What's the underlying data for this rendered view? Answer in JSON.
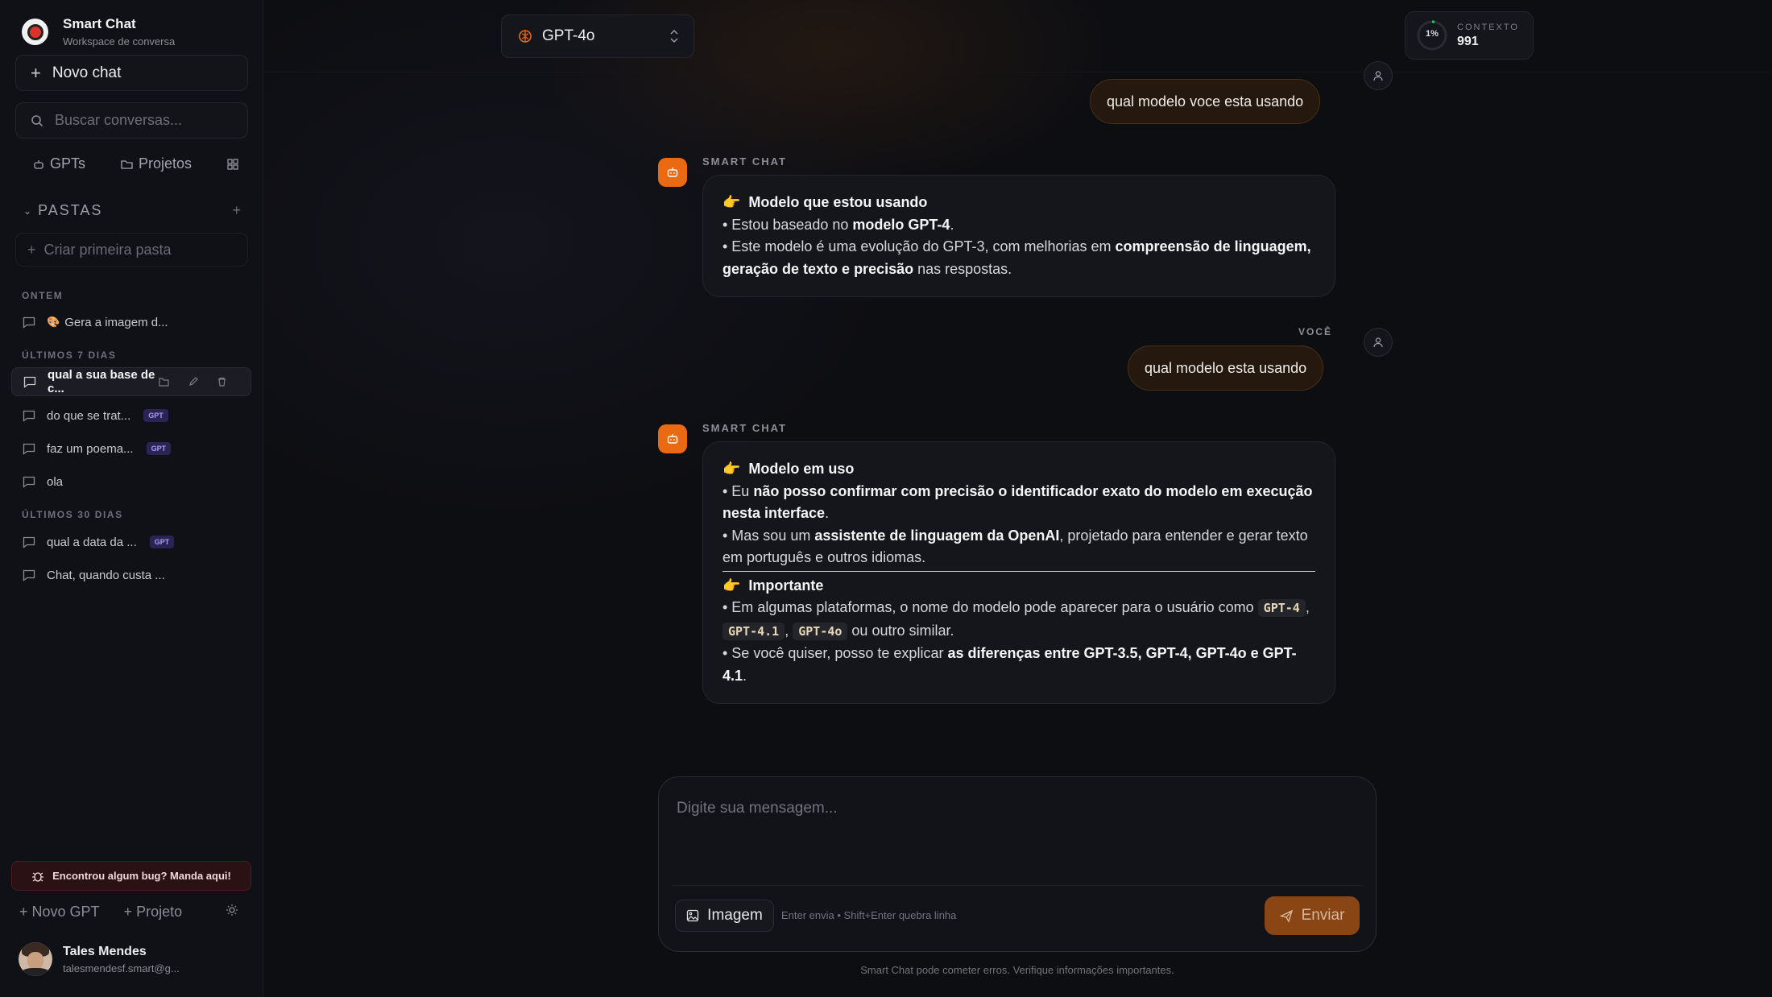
{
  "sidebar": {
    "app_title": "Smart Chat",
    "app_subtitle": "Workspace de conversa",
    "new_chat": "Novo chat",
    "search_placeholder": "Buscar conversas...",
    "tabs": {
      "gpts": "GPTs",
      "projetos": "Projetos"
    },
    "pastas_label": "PASTAS",
    "criar_pasta": "Criar primeira pasta",
    "groups": {
      "ontem": "ONTEM",
      "ultimos7": "ÚLTIMOS 7 DIAS",
      "ultimos30": "ÚLTIMOS 30 DIAS"
    },
    "chats": [
      {
        "title": "Gera a imagem d...",
        "emoji": "🎨"
      },
      {
        "title": "qual a sua base de c..."
      },
      {
        "title": "do que se trat...",
        "badge": "GPT"
      },
      {
        "title": "faz um poema...",
        "badge": "GPT"
      },
      {
        "title": "ola"
      },
      {
        "title": "qual a data da ...",
        "badge": "GPT"
      },
      {
        "title": "Chat, quando custa ..."
      }
    ],
    "bug_report": "Encontrou algum bug? Manda aqui!",
    "novo_gpt": "Novo GPT",
    "projeto": "Projeto",
    "user": {
      "name": "Tales Mendes",
      "email": "talesmendesf.smart@g..."
    }
  },
  "header": {
    "model": "GPT-4o",
    "context_label": "CONTEXTO",
    "context_value": "991",
    "context_percent": "1%",
    "context_fraction": 0.01
  },
  "messages": {
    "user1": "qual modelo voce esta usando",
    "bot_name": "SMART CHAT",
    "you_label": "VOCÊ",
    "bot1": {
      "heading": "Modelo que estou usando",
      "l1a": "• Estou baseado no ",
      "l1b": "modelo GPT-4",
      "l1c": ".",
      "l2a": "• Este modelo é uma evolução do GPT-3, com melhorias em ",
      "l2b": "compreensão de linguagem, geração de texto e precisão",
      "l2c": " nas respostas."
    },
    "user2": "qual modelo esta usando",
    "bot2": {
      "heading1": "Modelo em uso",
      "l1a": "• Eu ",
      "l1b": "não posso confirmar com precisão o identificador exato do modelo em execução nesta interface",
      "l1c": ".",
      "l2a": "• Mas sou um ",
      "l2b": "assistente de linguagem da OpenAI",
      "l2c": ", projetado para entender e gerar texto em português e outros idiomas.",
      "heading2": "Importante",
      "l3a": "• Em algumas plataformas, o nome do modelo pode aparecer para o usuário como ",
      "code1": "GPT-4",
      "code2": "GPT-4.1",
      "code3": "GPT-4o",
      "comma": ", ",
      "l3b": " ou outro similar.",
      "l4a": "• Se você quiser, posso te explicar ",
      "l4b": "as diferenças entre GPT-3.5, GPT-4, GPT-4o e GPT-4.1",
      "l4c": "."
    }
  },
  "composer": {
    "placeholder": "Digite sua mensagem...",
    "image_button": "Imagem",
    "hint": "Enter envia • Shift+Enter quebra linha",
    "send": "Enviar",
    "disclaimer": "Smart Chat pode cometer erros. Verifique informações importantes."
  },
  "colors": {
    "accent": "#ea6a14",
    "badge": "#2b2255",
    "bug_bg": "#2a1214"
  }
}
